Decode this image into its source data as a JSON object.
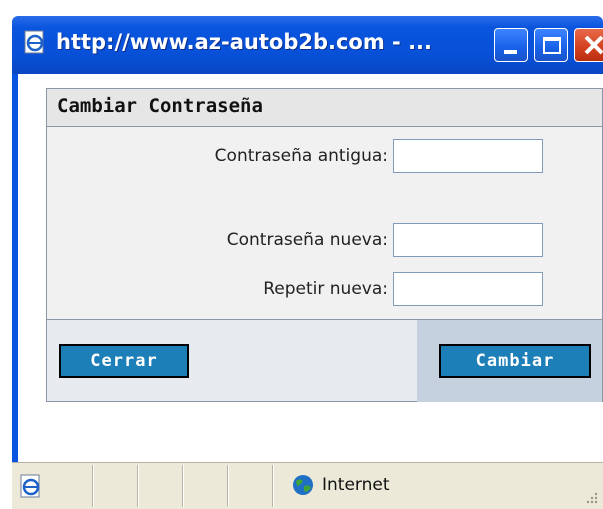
{
  "window": {
    "title": "http://www.az-autob2b.com - ...",
    "title_icon": "ie-page-icon",
    "buttons": [
      "minimize",
      "maximize",
      "close"
    ]
  },
  "panel": {
    "title": "Cambiar Contraseña",
    "fields": [
      {
        "label": "Contraseña antigua:",
        "value": ""
      },
      {
        "label": "Contraseña nueva:",
        "value": ""
      },
      {
        "label": "Repetir nueva:",
        "value": ""
      }
    ],
    "close_label": "Cerrar",
    "change_label": "Cambiar"
  },
  "statusbar": {
    "page_icon": "ie-page-icon",
    "zone_icon": "globe-icon",
    "zone_text": "Internet"
  },
  "colors": {
    "titlebar": "#0a55df",
    "button": "#1c7fb8",
    "close_button": "#d2401e"
  }
}
